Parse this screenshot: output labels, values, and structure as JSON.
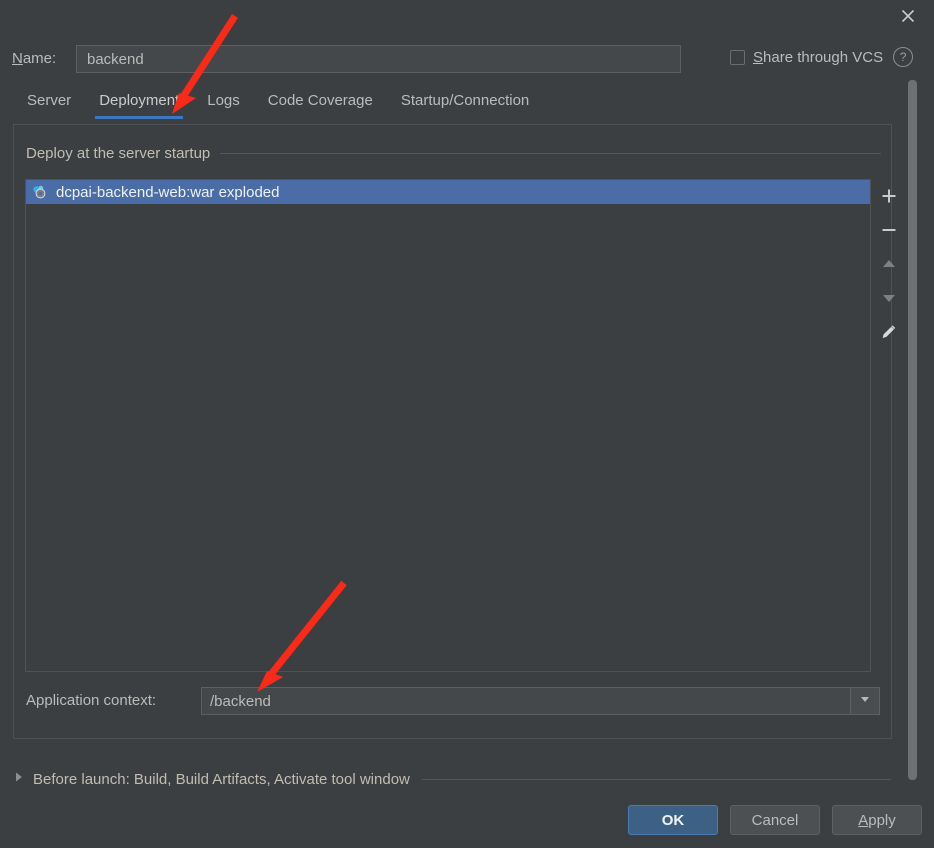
{
  "window": {
    "close_icon": "close-icon"
  },
  "name_row": {
    "label_mnemonic": "N",
    "label_rest": "ame:",
    "value": "backend",
    "placeholder": "",
    "vcs_mnemonic": "S",
    "vcs_rest": "hare through VCS",
    "vcs_checked": false,
    "help_glyph": "?"
  },
  "tabs": [
    {
      "label": "Server",
      "active": false
    },
    {
      "label": "Deployment",
      "active": true
    },
    {
      "label": "Logs",
      "active": false
    },
    {
      "label": "Code Coverage",
      "active": false
    },
    {
      "label": "Startup/Connection",
      "active": false
    }
  ],
  "deployment": {
    "group_title": "Deploy at the server startup",
    "list_items": [
      {
        "label": "dcpai-backend-web:war exploded",
        "icon": "artifact-icon",
        "selected": true
      }
    ],
    "toolbar": [
      {
        "name": "add-button",
        "icon": "plus-icon"
      },
      {
        "name": "remove-button",
        "icon": "minus-icon"
      },
      {
        "name": "move-up-button",
        "icon": "arrow-up-icon"
      },
      {
        "name": "move-down-button",
        "icon": "arrow-down-icon"
      },
      {
        "name": "edit-button",
        "icon": "pencil-icon"
      }
    ],
    "context_label": "Application context:",
    "context_value": "/backend",
    "context_placeholder": ""
  },
  "before_launch": {
    "text": "Before launch: Build, Build Artifacts, Activate tool window",
    "expanded": false
  },
  "buttons": {
    "ok": "OK",
    "cancel": "Cancel",
    "apply_mnemonic": "A",
    "apply_rest": "pply"
  },
  "colors": {
    "background": "#3c3f41",
    "selection": "#4a6da7",
    "accent": "#3d77c2",
    "primary_button": "#3d6185",
    "text": "#bbbbbb",
    "annotation": "#fa2a18"
  }
}
